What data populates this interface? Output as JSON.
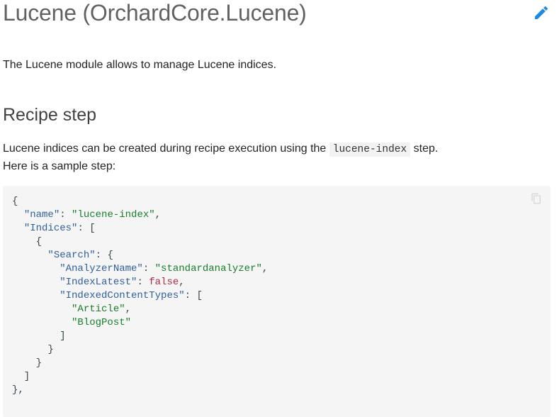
{
  "header": {
    "title": "Lucene (OrchardCore.Lucene)",
    "edit_icon": "pencil-icon"
  },
  "intro": "The Lucene module allows to manage Lucene indices.",
  "recipe": {
    "heading": "Recipe step",
    "text_before": "Lucene indices can be created during recipe execution using the ",
    "code_inline": "lucene-index",
    "text_after": " step.",
    "line2": "Here is a sample step:"
  },
  "code": {
    "copy_icon": "copy-icon",
    "lines": [
      [
        [
          "p",
          "{"
        ]
      ],
      [
        [
          "p",
          "  "
        ],
        [
          "k",
          "\"name\""
        ],
        [
          "p",
          ": "
        ],
        [
          "s",
          "\"lucene-index\""
        ],
        [
          "p",
          ","
        ]
      ],
      [
        [
          "p",
          "  "
        ],
        [
          "k",
          "\"Indices\""
        ],
        [
          "p",
          ": ["
        ]
      ],
      [
        [
          "p",
          "    {"
        ]
      ],
      [
        [
          "p",
          "      "
        ],
        [
          "k",
          "\"Search\""
        ],
        [
          "p",
          ": {"
        ]
      ],
      [
        [
          "p",
          "        "
        ],
        [
          "k",
          "\"AnalyzerName\""
        ],
        [
          "p",
          ": "
        ],
        [
          "s",
          "\"standardanalyzer\""
        ],
        [
          "p",
          ","
        ]
      ],
      [
        [
          "p",
          "        "
        ],
        [
          "k",
          "\"IndexLatest\""
        ],
        [
          "p",
          ": "
        ],
        [
          "b",
          "false"
        ],
        [
          "p",
          ","
        ]
      ],
      [
        [
          "p",
          "        "
        ],
        [
          "k",
          "\"IndexedContentTypes\""
        ],
        [
          "p",
          ": ["
        ]
      ],
      [
        [
          "p",
          "          "
        ],
        [
          "s",
          "\"Article\""
        ],
        [
          "p",
          ","
        ]
      ],
      [
        [
          "p",
          "          "
        ],
        [
          "s",
          "\"BlogPost\""
        ]
      ],
      [
        [
          "p",
          "        ]"
        ]
      ],
      [
        [
          "p",
          "      }"
        ]
      ],
      [
        [
          "p",
          "    }"
        ]
      ],
      [
        [
          "p",
          "  ]"
        ]
      ],
      [
        [
          "p",
          "},"
        ]
      ]
    ]
  },
  "colors": {
    "accent": "#1e88e5",
    "code_bg": "#f5f5f5",
    "code_key": "#2f5f9a",
    "code_string": "#177d2b",
    "code_bool": "#b02a4a"
  }
}
